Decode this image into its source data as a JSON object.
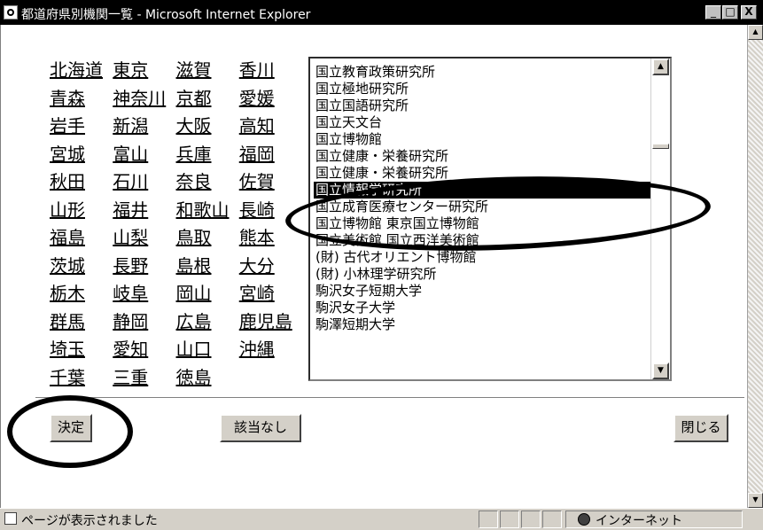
{
  "window": {
    "title": "都道府県別機関一覧 - Microsoft Internet Explorer",
    "minimize": "_",
    "maximize": "□",
    "close": "X"
  },
  "prefectures": [
    [
      "北海道",
      "東京",
      "滋賀",
      "香川"
    ],
    [
      "青森",
      "神奈川",
      "京都",
      "愛媛"
    ],
    [
      "岩手",
      "新潟",
      "大阪",
      "高知"
    ],
    [
      "宮城",
      "富山",
      "兵庫",
      "福岡"
    ],
    [
      "秋田",
      "石川",
      "奈良",
      "佐賀"
    ],
    [
      "山形",
      "福井",
      "和歌山",
      "長崎"
    ],
    [
      "福島",
      "山梨",
      "鳥取",
      "熊本"
    ],
    [
      "茨城",
      "長野",
      "島根",
      "大分"
    ],
    [
      "栃木",
      "岐阜",
      "岡山",
      "宮崎"
    ],
    [
      "群馬",
      "静岡",
      "広島",
      "鹿児島"
    ],
    [
      "埼玉",
      "愛知",
      "山口",
      "沖縄"
    ],
    [
      "千葉",
      "三重",
      "徳島",
      ""
    ]
  ],
  "institutions": {
    "items": [
      "国立教育政策研究所",
      "国立極地研究所",
      "国立国語研究所",
      "国立天文台",
      "国立博物館",
      "国立健康・栄養研究所",
      "国立健康・栄養研究所",
      "国立情報学研究所",
      "国立成育医療センター研究所",
      "国立博物館 東京国立博物館",
      "国立美術館 国立西洋美術館",
      "(財) 古代オリエント博物館",
      "(財) 小林理学研究所",
      "駒沢女子短期大学",
      "駒沢女子大学",
      "駒澤短期大学"
    ],
    "selected_index": 7,
    "scroll_up": "▲",
    "scroll_down": "▼"
  },
  "buttons": {
    "decide": "決定",
    "none": "該当なし",
    "close": "閉じる"
  },
  "scroll": {
    "up": "▲",
    "down": "▼"
  },
  "status": {
    "text": "ページが表示されました",
    "zone": "インターネット"
  }
}
